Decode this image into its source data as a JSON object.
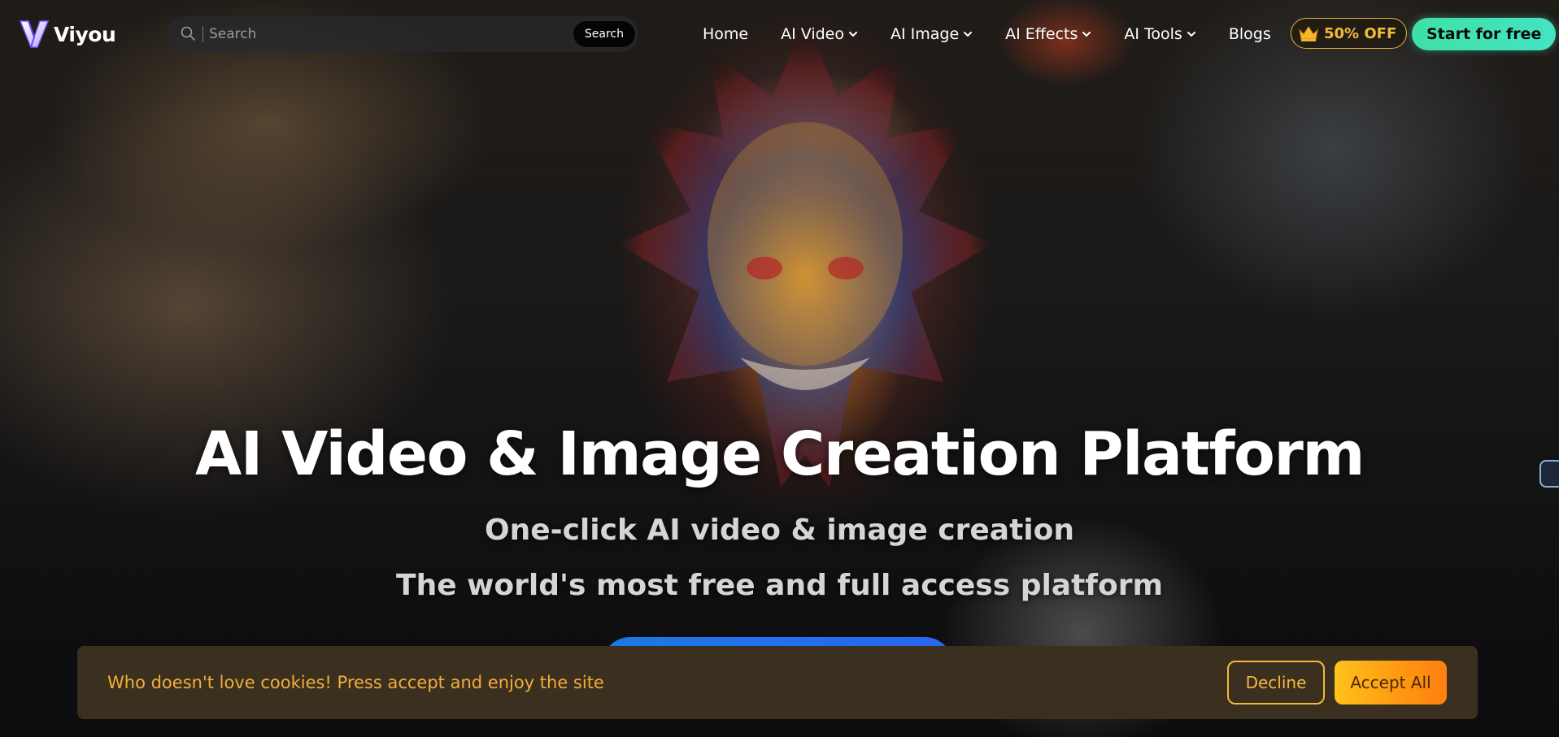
{
  "brand": {
    "name": "Viyou"
  },
  "search": {
    "placeholder": "Search",
    "button_label": "Search"
  },
  "nav": {
    "items": [
      {
        "label": "Home",
        "dropdown": false
      },
      {
        "label": "AI Video",
        "dropdown": true
      },
      {
        "label": "AI Image",
        "dropdown": true
      },
      {
        "label": "AI Effects",
        "dropdown": true
      },
      {
        "label": "AI Tools",
        "dropdown": true
      },
      {
        "label": "Blogs",
        "dropdown": false
      }
    ]
  },
  "promo": {
    "label": "50% OFF",
    "icon": "crown-icon"
  },
  "cta": {
    "start_label": "Start for free"
  },
  "hero": {
    "title": "AI Video & Image Creation Platform",
    "subtitle_1": "One-click AI video & image creation",
    "subtitle_2": "The world's most free and full access platform"
  },
  "cookie": {
    "message": "Who doesn't love cookies! Press accept and enjoy the site",
    "decline_label": "Decline",
    "accept_label": "Accept All"
  },
  "colors": {
    "accent_green": "#3fe0a6",
    "promo_gold": "#f3b93a",
    "cookie_bg": "#3b3020",
    "accept_orange": "#ff9a12",
    "cta_blue": "#1b79e6"
  }
}
